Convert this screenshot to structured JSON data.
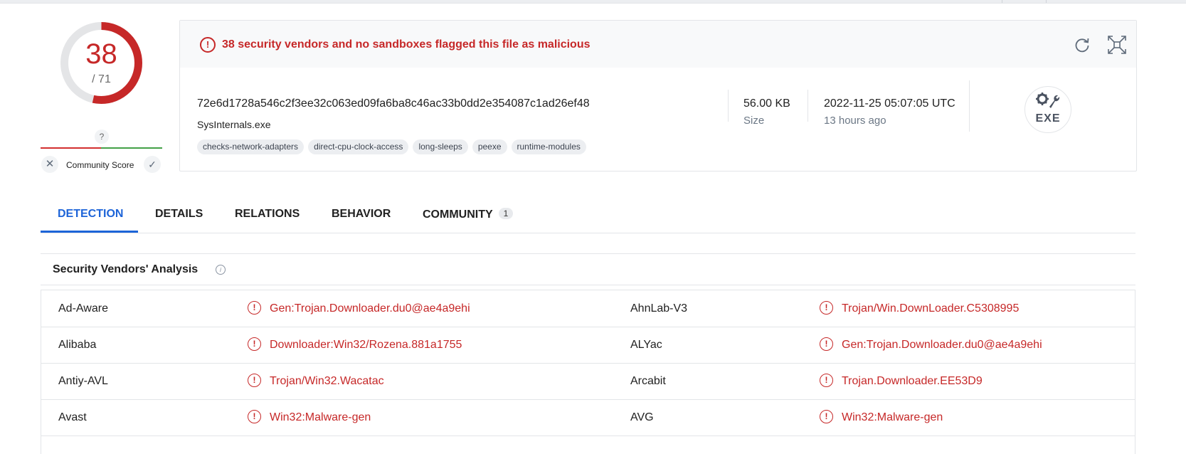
{
  "score": {
    "detections": "38",
    "total": "/ 71",
    "detection_fraction": 0.535,
    "community_unknown": "?",
    "community_label": "Community Score",
    "colors": {
      "malicious": "#c62828",
      "track": "#e0e0e0",
      "good": "#43a047"
    }
  },
  "summary": {
    "alert_icon": "alert-circle-icon",
    "alert_text": "38 security vendors and no sandboxes flagged this file as malicious",
    "reload_icon": "reload-icon",
    "expand_icon": "graph-expand-icon"
  },
  "file": {
    "hash": "72e6d1728a546c2f3ee32c063ed09fa6ba8c46ac33b0dd2e354087c1ad26ef48",
    "name": "SysInternals.exe",
    "tags": [
      "checks-network-adapters",
      "direct-cpu-clock-access",
      "long-sleeps",
      "peexe",
      "runtime-modules"
    ],
    "size_value": "56.00 KB",
    "size_label": "Size",
    "date_value": "2022-11-25 05:07:05 UTC",
    "date_relative": "13 hours ago",
    "type_label": "EXE",
    "type_icon": "exe-file-type-icon"
  },
  "tabs": [
    {
      "label": "DETECTION",
      "active": true
    },
    {
      "label": "DETAILS"
    },
    {
      "label": "RELATIONS"
    },
    {
      "label": "BEHAVIOR"
    },
    {
      "label": "COMMUNITY",
      "badge": "1"
    }
  ],
  "vendors": {
    "title": "Security Vendors' Analysis",
    "info_icon": "info-icon",
    "rows": [
      {
        "left_name": "Ad-Aware",
        "left_result": "Gen:Trojan.Downloader.du0@ae4a9ehi",
        "right_name": "AhnLab-V3",
        "right_result": "Trojan/Win.DownLoader.C5308995"
      },
      {
        "left_name": "Alibaba",
        "left_result": "Downloader:Win32/Rozena.881a1755",
        "right_name": "ALYac",
        "right_result": "Gen:Trojan.Downloader.du0@ae4a9ehi"
      },
      {
        "left_name": "Antiy-AVL",
        "left_result": "Trojan/Win32.Wacatac",
        "right_name": "Arcabit",
        "right_result": "Trojan.Downloader.EE53D9"
      },
      {
        "left_name": "Avast",
        "left_result": "Win32:Malware-gen",
        "right_name": "AVG",
        "right_result": "Win32:Malware-gen"
      }
    ]
  }
}
